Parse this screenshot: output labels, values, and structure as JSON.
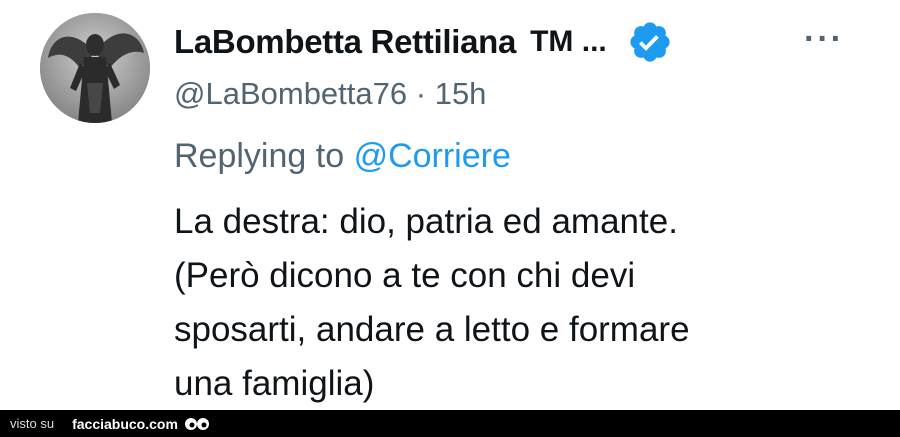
{
  "tweet": {
    "display_name": "LaBombetta Rettiliana",
    "name_suffix": "TM ...",
    "handle": "@LaBombetta76",
    "separator": "·",
    "time": "15h",
    "more_label": "···",
    "reply_prefix": "Replying to",
    "reply_to": "@Corriere",
    "body_lines": [
      "La destra: dio, patria ed amante.",
      "(Però dicono a te con chi devi",
      "sposarti, andare a letto e formare",
      "una famiglia)"
    ]
  },
  "footer": {
    "seen_on": "visto su",
    "brand": "facciabuco.com"
  },
  "icons": {
    "verified": "verified-badge-icon",
    "more": "more-options-icon",
    "avatar": "statue-avatar"
  },
  "colors": {
    "name": "#0f1419",
    "secondary": "#536471",
    "accent": "#1d9bf0",
    "footer_bg": "#000000"
  }
}
